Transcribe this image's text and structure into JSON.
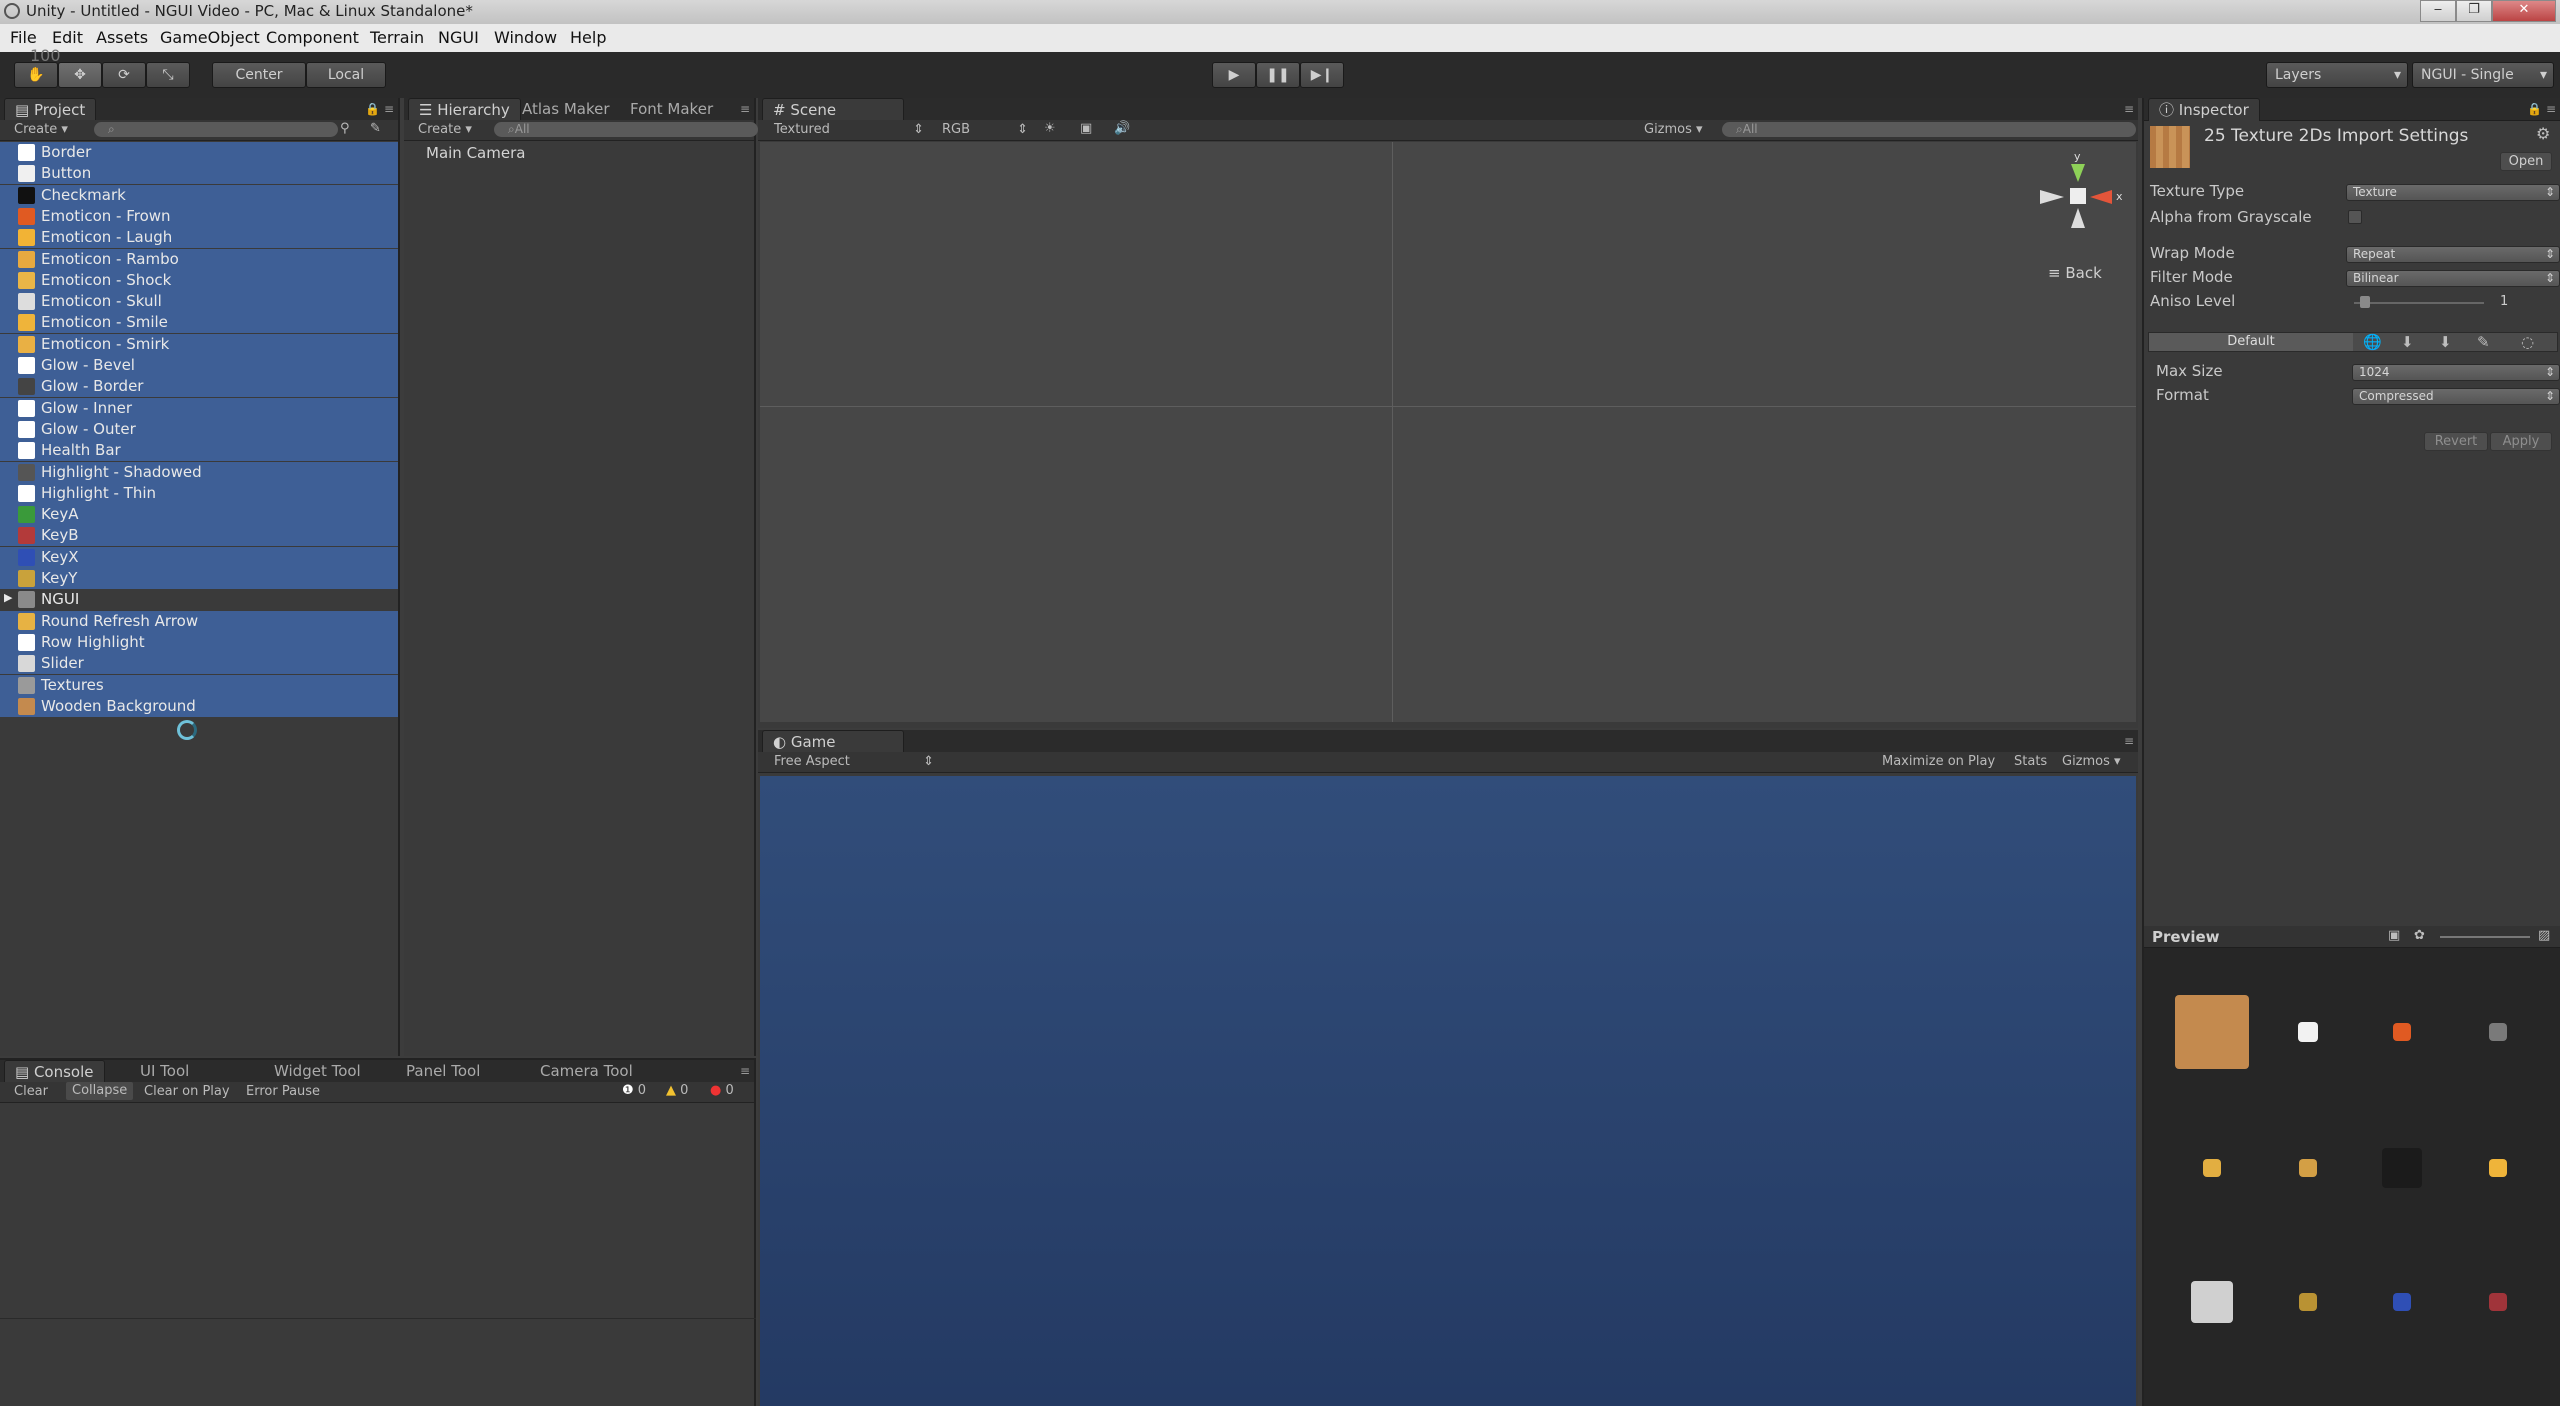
{
  "window": {
    "title": "Unity - Untitled - NGUI Video - PC, Mac & Linux Standalone*",
    "controls": [
      "‒",
      "❐",
      "✕"
    ]
  },
  "menubar": [
    "File",
    "Edit",
    "Assets",
    "GameObject",
    "Component",
    "Terrain",
    "NGUI",
    "Window",
    "Help"
  ],
  "toolbar": {
    "overlay_text": "100",
    "pivot": "Center",
    "space": "Local",
    "layers": "Layers",
    "layout": "NGUI - Single"
  },
  "project": {
    "tab": "Project",
    "create": "Create",
    "items": [
      {
        "label": "Border",
        "color": "#ffffff"
      },
      {
        "label": "Button",
        "color": "#f0f0f0"
      },
      {
        "label": "Checkmark",
        "color": "#111111"
      },
      {
        "label": "Emoticon - Frown",
        "color": "#e05a22"
      },
      {
        "label": "Emoticon - Laugh",
        "color": "#f2b335"
      },
      {
        "label": "Emoticon - Rambo",
        "color": "#e7a940"
      },
      {
        "label": "Emoticon - Shock",
        "color": "#e9b547"
      },
      {
        "label": "Emoticon - Skull",
        "color": "#dddddd"
      },
      {
        "label": "Emoticon - Smile",
        "color": "#efb43a"
      },
      {
        "label": "Emoticon - Smirk",
        "color": "#e9b044"
      },
      {
        "label": "Glow - Bevel",
        "color": "#ffffff"
      },
      {
        "label": "Glow - Border",
        "color": "#444444"
      },
      {
        "label": "Glow - Inner",
        "color": "#ffffff"
      },
      {
        "label": "Glow - Outer",
        "color": "#ffffff"
      },
      {
        "label": "Health Bar",
        "color": "#ffffff"
      },
      {
        "label": "Highlight - Shadowed",
        "color": "#555555"
      },
      {
        "label": "Highlight - Thin",
        "color": "#ffffff"
      },
      {
        "label": "KeyA",
        "color": "#3a9a3a"
      },
      {
        "label": "KeyB",
        "color": "#b33a3a"
      },
      {
        "label": "KeyX",
        "color": "#2f4fb5"
      },
      {
        "label": "KeyY",
        "color": "#c9a23b"
      },
      {
        "label": "NGUI",
        "color": "#8a8a8a"
      },
      {
        "label": "Round Refresh Arrow",
        "color": "#e7b243"
      },
      {
        "label": "Row Highlight",
        "color": "#ffffff"
      },
      {
        "label": "Slider",
        "color": "#d8d8d8"
      },
      {
        "label": "Textures",
        "color": "#9a9a9a"
      },
      {
        "label": "Wooden Background",
        "color": "#c48a4e"
      }
    ]
  },
  "hierarchy": {
    "tabs": [
      "Hierarchy",
      "Atlas Maker",
      "Font Maker"
    ],
    "create": "Create",
    "search": "All",
    "items": [
      "Main Camera"
    ]
  },
  "scene": {
    "tab": "Scene",
    "render_mode": "Textured",
    "channel": "RGB",
    "gizmos": "Gizmos",
    "search": "All",
    "gizmo_axes": {
      "y": "y",
      "x": "x"
    },
    "view_label": "Back"
  },
  "game": {
    "tab": "Game",
    "aspect": "Free Aspect",
    "maximize": "Maximize on Play",
    "stats": "Stats",
    "gizmos": "Gizmos"
  },
  "console": {
    "tabs": [
      "Console",
      "UI Tool",
      "Widget Tool",
      "Panel Tool",
      "Camera Tool"
    ],
    "buttons": [
      "Clear",
      "Collapse",
      "Clear on Play",
      "Error Pause"
    ],
    "counts": {
      "info": "0",
      "warn": "0",
      "error": "0"
    }
  },
  "inspector": {
    "tab": "Inspector",
    "header": "25 Texture 2Ds Import Settings",
    "open": "Open",
    "texture_type_label": "Texture Type",
    "texture_type": "Texture",
    "alpha_label": "Alpha from Grayscale",
    "wrap_label": "Wrap Mode",
    "wrap": "Repeat",
    "filter_label": "Filter Mode",
    "filter": "Bilinear",
    "aniso_label": "Aniso Level",
    "aniso": "1",
    "platform_default": "Default",
    "max_size_label": "Max Size",
    "max_size": "1024",
    "format_label": "Format",
    "format": "Compressed",
    "revert": "Revert",
    "apply": "Apply"
  },
  "preview": {
    "title": "Preview",
    "sprites": [
      {
        "name": "wooden-background",
        "color": "#c48a4e"
      },
      {
        "name": "white-square",
        "color": "#f2f2f2"
      },
      {
        "name": "emoticon-frown",
        "color": "#e05a22"
      },
      {
        "name": "border",
        "color": "#7a7a7a"
      },
      {
        "name": "emoticon-smirk",
        "color": "#e2ae41"
      },
      {
        "name": "emoticon-rambo",
        "color": "#d39f45"
      },
      {
        "name": "glow-border",
        "color": "#1b1b1b"
      },
      {
        "name": "emoticon-smile",
        "color": "#efb43a"
      },
      {
        "name": "slider",
        "color": "#d0d0d0"
      },
      {
        "name": "keyy",
        "color": "#b99233"
      },
      {
        "name": "keyx",
        "color": "#2f4fb5"
      },
      {
        "name": "keyb",
        "color": "#a0343a"
      }
    ]
  }
}
